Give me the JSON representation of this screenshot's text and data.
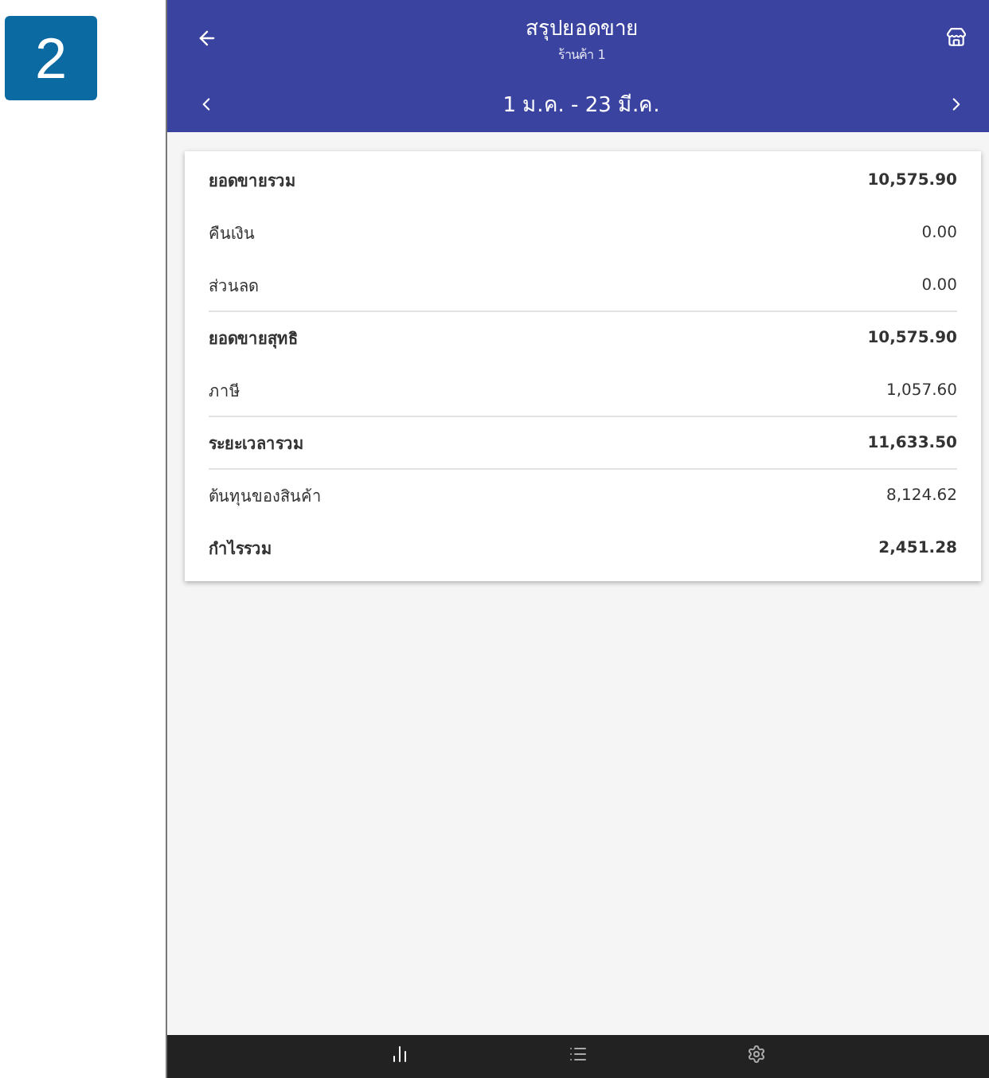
{
  "step_badge": "2",
  "header": {
    "title": "สรุปยอดขาย",
    "subtitle": "ร้านค้า 1",
    "date_range": "1 ม.ค. - 23 มี.ค."
  },
  "summary_rows": [
    {
      "label": "ยอดขายรวม",
      "value": "10,575.90",
      "kind": "total",
      "divider": false
    },
    {
      "label": "คืนเงิน",
      "value": "0.00",
      "kind": "item",
      "divider": false
    },
    {
      "label": "ส่วนลด",
      "value": "0.00",
      "kind": "item",
      "divider": true
    },
    {
      "label": "ยอดขายสุทธิ",
      "value": "10,575.90",
      "kind": "total",
      "divider": false
    },
    {
      "label": "ภาษี",
      "value": "1,057.60",
      "kind": "item",
      "divider": true
    },
    {
      "label": "ระยะเวลารวม",
      "value": "11,633.50",
      "kind": "total",
      "divider": true
    },
    {
      "label": "ต้นทุนของสินค้า",
      "value": "8,124.62",
      "kind": "item",
      "divider": false
    },
    {
      "label": "กำไรรวม",
      "value": "2,451.28",
      "kind": "total",
      "divider": false
    }
  ],
  "bottom_nav": [
    {
      "kind": "chart",
      "selected": true
    },
    {
      "kind": "list",
      "selected": false
    },
    {
      "kind": "settings",
      "selected": false
    }
  ]
}
